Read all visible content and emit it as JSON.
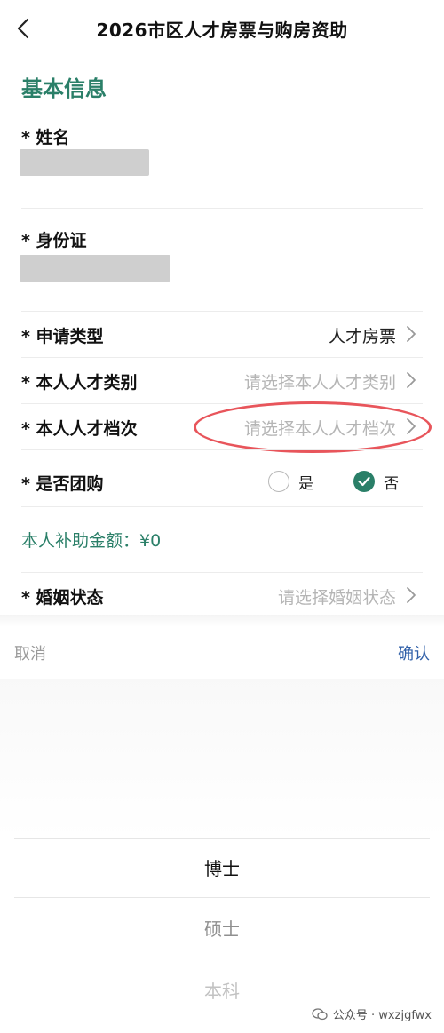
{
  "header": {
    "title": "2026市区人才房票与购房资助"
  },
  "section": {
    "title": "基本信息"
  },
  "fields": {
    "name_label": "* 姓名",
    "id_label": "* 身份证",
    "apply_type_label": "* 申请类型",
    "apply_type_value": "人才房票",
    "talent_category_label": "* 本人人才类别",
    "talent_category_placeholder": "请选择本人人才类别",
    "talent_level_label": "* 本人人才档次",
    "talent_level_placeholder": "请选择本人人才档次",
    "group_buy_label": "* 是否团购",
    "group_buy_yes": "是",
    "group_buy_no": "否",
    "marital_label": "* 婚姻状态",
    "marital_placeholder": "请选择婚姻状态"
  },
  "subsidy": {
    "text": "本人补助金额：¥0"
  },
  "picker": {
    "cancel": "取消",
    "confirm": "确认",
    "options": [
      "博士",
      "硕士",
      "本科"
    ]
  },
  "watermark": {
    "text": "公众号 · wxzjgfwx"
  },
  "colors": {
    "accent": "#2a7f68",
    "annotation": "#e8555b",
    "confirm": "#2f5fa8"
  }
}
